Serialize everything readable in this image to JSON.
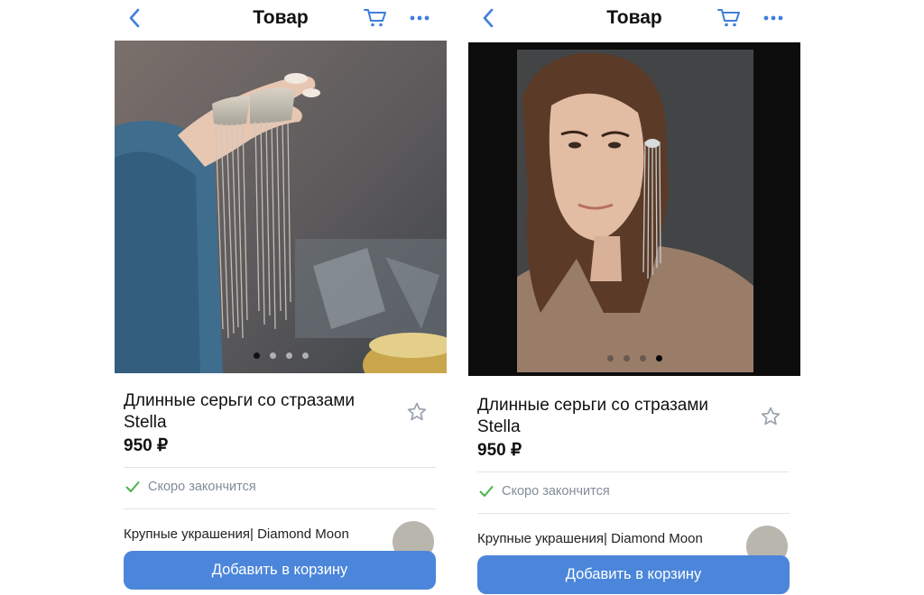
{
  "colors": {
    "accent": "#4b86da",
    "icon_blue": "#3f7fdc",
    "success_green": "#4bb34b",
    "muted_text": "#818c99"
  },
  "screens": [
    {
      "header": {
        "title": "Товар",
        "back_icon": "chevron-left-icon",
        "cart_icon": "cart-icon",
        "more_icon": "more-horizontal-icon"
      },
      "gallery": {
        "image": "earrings-held-in-hand-photo",
        "slide_count": 4,
        "active_slide": 1
      },
      "product": {
        "title": "Длинные серьги со стразами Stella",
        "price": "950 ₽",
        "favorite_icon": "star-outline-icon"
      },
      "stock_status": "Скоро закончится",
      "shop": {
        "name": "Крупные украшения| Diamond Moon"
      },
      "add_to_cart_label": "Добавить в корзину"
    },
    {
      "header": {
        "title": "Товар",
        "back_icon": "chevron-left-icon",
        "cart_icon": "cart-icon",
        "more_icon": "more-horizontal-icon"
      },
      "gallery": {
        "image": "woman-wearing-earring-photo",
        "slide_count": 4,
        "active_slide": 4
      },
      "product": {
        "title": "Длинные серьги со стразами Stella",
        "price": "950 ₽",
        "favorite_icon": "star-outline-icon"
      },
      "stock_status": "Скоро закончится",
      "shop": {
        "name": "Крупные украшения| Diamond Moon"
      },
      "add_to_cart_label": "Добавить в корзину"
    }
  ]
}
